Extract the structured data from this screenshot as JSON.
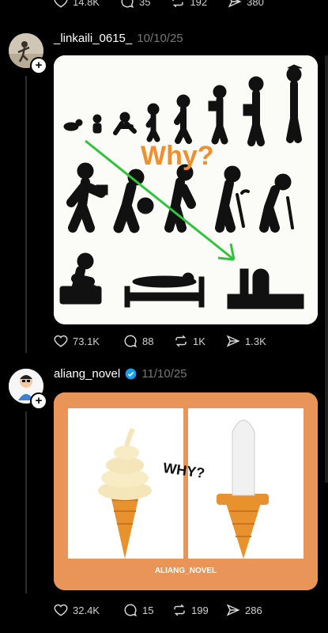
{
  "prev_post": {
    "likes": "14.8K",
    "comments": "35",
    "reposts": "192",
    "shares": "380"
  },
  "post1": {
    "username": "_linkaili_0615_",
    "date": "10/10/25",
    "image_text": "Why?",
    "likes": "73.1K",
    "comments": "88",
    "reposts": "1K",
    "shares": "1.3K"
  },
  "post2": {
    "username": "aliang_novel",
    "date": "11/10/25",
    "image_text": "WHY?",
    "watermark": "ALIANG_NOVEL",
    "likes": "32.4K",
    "comments": "15",
    "reposts": "199",
    "shares": "286"
  },
  "colors": {
    "background": "#000000",
    "secondary_text": "#777777",
    "verified": "#1d9bf0",
    "arrow_green": "#2fc43a",
    "why_orange": "#f0902a",
    "media2_frame": "#e9955a"
  },
  "icons": [
    "heart-icon",
    "comment-icon",
    "repost-icon",
    "share-icon",
    "verified-icon",
    "plus-icon"
  ]
}
